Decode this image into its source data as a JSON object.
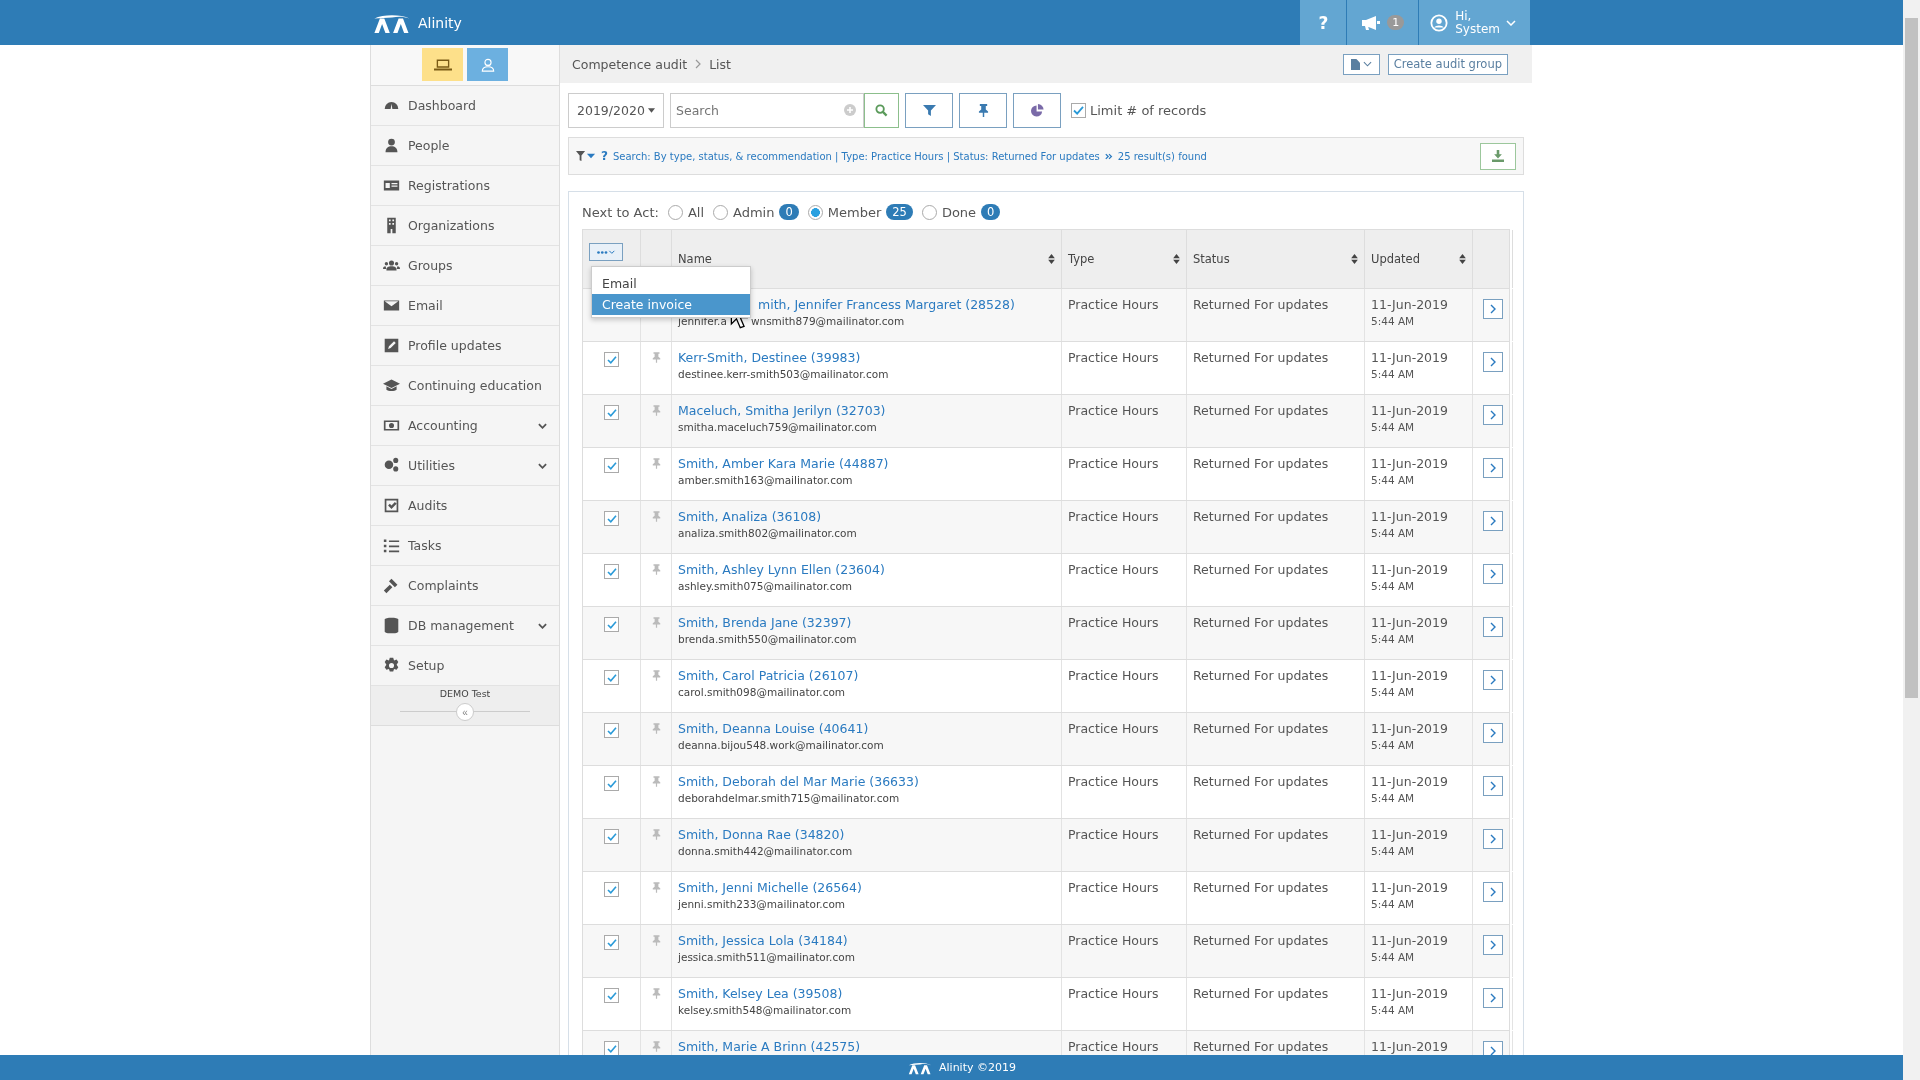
{
  "app": {
    "name": "Alinity"
  },
  "header": {
    "help": "?",
    "notifications": "1",
    "greeting": "Hi,",
    "user": "System"
  },
  "sidebar": {
    "items": [
      {
        "label": "Dashboard",
        "expandable": false
      },
      {
        "label": "People",
        "expandable": false
      },
      {
        "label": "Registrations",
        "expandable": false
      },
      {
        "label": "Organizations",
        "expandable": false
      },
      {
        "label": "Groups",
        "expandable": false
      },
      {
        "label": "Email",
        "expandable": false
      },
      {
        "label": "Profile updates",
        "expandable": false
      },
      {
        "label": "Continuing education",
        "expandable": false
      },
      {
        "label": "Accounting",
        "expandable": true
      },
      {
        "label": "Utilities",
        "expandable": true
      },
      {
        "label": "Audits",
        "expandable": false
      },
      {
        "label": "Tasks",
        "expandable": false
      },
      {
        "label": "Complaints",
        "expandable": false
      },
      {
        "label": "DB management",
        "expandable": true
      },
      {
        "label": "Setup",
        "expandable": false
      }
    ],
    "db_label": "DEMO Test",
    "collapse": "«"
  },
  "breadcrumb": [
    "Competence audit",
    "List"
  ],
  "create_button": "Create audit group",
  "toolbar": {
    "year": "2019/2020",
    "search_placeholder": "Search",
    "limit": {
      "label": "Limit # of records",
      "checked": true
    }
  },
  "filter_summary": {
    "help": "?",
    "text": "Search: By type, status, & recommendation | Type: Practice Hours | Status: Returned For updates",
    "results": "25 result(s) found"
  },
  "next_to_act": {
    "label": "Next to Act:",
    "options": [
      {
        "label": "All",
        "selected": false
      },
      {
        "label": "Admin",
        "count": "0",
        "selected": false
      },
      {
        "label": "Member",
        "count": "25",
        "selected": true
      },
      {
        "label": "Done",
        "count": "0",
        "selected": false
      }
    ]
  },
  "table": {
    "columns": [
      "Name",
      "Type",
      "Status",
      "Updated"
    ],
    "rows": [
      {
        "name": "mith, Jennifer Francess Margaret (28528)",
        "email": "jennifer.a",
        "email_tail": "wnsmith879@mailinator.com",
        "type": "Practice Hours",
        "status": "Returned For updates",
        "date": "11-Jun-2019",
        "time": "5:44 AM"
      },
      {
        "checked": true,
        "name": "Kerr-Smith, Destinee (39983)",
        "email": "destinee.kerr-smith503@mailinator.com",
        "type": "Practice Hours",
        "status": "Returned For updates",
        "date": "11-Jun-2019",
        "time": "5:44 AM"
      },
      {
        "checked": true,
        "name": "Maceluch, Smitha Jerilyn (32703)",
        "email": "smitha.maceluch759@mailinator.com",
        "type": "Practice Hours",
        "status": "Returned For updates",
        "date": "11-Jun-2019",
        "time": "5:44 AM"
      },
      {
        "checked": true,
        "name": "Smith, Amber Kara Marie (44887)",
        "email": "amber.smith163@mailinator.com",
        "type": "Practice Hours",
        "status": "Returned For updates",
        "date": "11-Jun-2019",
        "time": "5:44 AM"
      },
      {
        "checked": true,
        "name": "Smith, Analiza (36108)",
        "email": "analiza.smith802@mailinator.com",
        "type": "Practice Hours",
        "status": "Returned For updates",
        "date": "11-Jun-2019",
        "time": "5:44 AM"
      },
      {
        "checked": true,
        "name": "Smith, Ashley Lynn Ellen (23604)",
        "email": "ashley.smith075@mailinator.com",
        "type": "Practice Hours",
        "status": "Returned For updates",
        "date": "11-Jun-2019",
        "time": "5:44 AM"
      },
      {
        "checked": true,
        "name": "Smith, Brenda Jane (32397)",
        "email": "brenda.smith550@mailinator.com",
        "type": "Practice Hours",
        "status": "Returned For updates",
        "date": "11-Jun-2019",
        "time": "5:44 AM"
      },
      {
        "checked": true,
        "name": "Smith, Carol Patricia (26107)",
        "email": "carol.smith098@mailinator.com",
        "type": "Practice Hours",
        "status": "Returned For updates",
        "date": "11-Jun-2019",
        "time": "5:44 AM"
      },
      {
        "checked": true,
        "name": "Smith, Deanna Louise (40641)",
        "email": "deanna.bijou548.work@mailinator.com",
        "type": "Practice Hours",
        "status": "Returned For updates",
        "date": "11-Jun-2019",
        "time": "5:44 AM"
      },
      {
        "checked": true,
        "name": "Smith, Deborah del Mar Marie (36633)",
        "email": "deborahdelmar.smith715@mailinator.com",
        "type": "Practice Hours",
        "status": "Returned For updates",
        "date": "11-Jun-2019",
        "time": "5:44 AM"
      },
      {
        "checked": true,
        "name": "Smith, Donna Rae (34820)",
        "email": "donna.smith442@mailinator.com",
        "type": "Practice Hours",
        "status": "Returned For updates",
        "date": "11-Jun-2019",
        "time": "5:44 AM"
      },
      {
        "checked": true,
        "name": "Smith, Jenni Michelle (26564)",
        "email": "jenni.smith233@mailinator.com",
        "type": "Practice Hours",
        "status": "Returned For updates",
        "date": "11-Jun-2019",
        "time": "5:44 AM"
      },
      {
        "checked": true,
        "name": "Smith, Jessica Lola (34184)",
        "email": "jessica.smith511@mailinator.com",
        "type": "Practice Hours",
        "status": "Returned For updates",
        "date": "11-Jun-2019",
        "time": "5:44 AM"
      },
      {
        "checked": true,
        "name": "Smith, Kelsey Lea (39508)",
        "email": "kelsey.smith548@mailinator.com",
        "type": "Practice Hours",
        "status": "Returned For updates",
        "date": "11-Jun-2019",
        "time": "5:44 AM"
      },
      {
        "checked": true,
        "name": "Smith, Marie A Brinn (42575)",
        "type": "Practice Hours",
        "status": "Returned For updates",
        "date": "11-Jun-2019"
      }
    ]
  },
  "menu": {
    "items": [
      {
        "label": "Email",
        "selected": false
      },
      {
        "label": "Create invoice",
        "selected": true
      }
    ]
  },
  "footer": "Alinity ©2019"
}
